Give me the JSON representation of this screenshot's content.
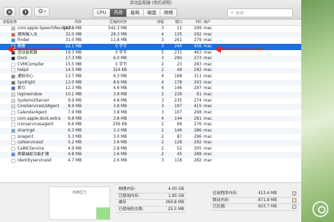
{
  "window": {
    "title": "活动监视器 (我的进程)"
  },
  "toolbar": {
    "close_glyph": "×",
    "info_glyph": "i",
    "gear_glyph": "⚙",
    "caret_glyph": "▾"
  },
  "tabs": [
    {
      "label": "CPU",
      "active": false
    },
    {
      "label": "内存",
      "active": true
    },
    {
      "label": "能耗",
      "active": false
    },
    {
      "label": "磁盘",
      "active": false
    },
    {
      "label": "网络",
      "active": false
    }
  ],
  "search": {
    "icon": "search-icon",
    "glyph": "⌕",
    "placeholder": "搜索"
  },
  "columns": {
    "name": "进程名称",
    "memory": "内存",
    "compressed": "压缩的内存",
    "threads": "线程",
    "ports": "端口",
    "pid": "PID",
    "user": "用户"
  },
  "processes": [
    {
      "name": "com.apple.SpeechRecognit...",
      "memory": "542.8 MB",
      "compressed": "542.3 MB",
      "threads": "3",
      "ports": "11",
      "pid": "299",
      "user": "mac",
      "color": "#bdbdbd"
    },
    {
      "name": "搜狗输入法",
      "memory": "32.0 MB",
      "compressed": "28.3 MB",
      "threads": "4",
      "ports": "135",
      "pid": "292",
      "user": "mac",
      "color": "#e3563b"
    },
    {
      "name": "Finder",
      "memory": "31.0 MB",
      "compressed": "11.8 MB",
      "threads": "3",
      "ports": "261",
      "pid": "279",
      "user": "mac",
      "color": "#3f8fe0"
    },
    {
      "name": "瞧瞧",
      "memory": "22.1 MB",
      "compressed": "0 字节",
      "threads": "3",
      "ports": "244",
      "pid": "456",
      "user": "mac",
      "color": "#2a6fd0"
    },
    {
      "name": "活动监视器",
      "memory": "19.3 MB",
      "compressed": "0 字节",
      "threads": "5",
      "ports": "231",
      "pid": "463",
      "user": "mac",
      "color": "#3b3b3b"
    },
    {
      "name": "Dock",
      "memory": "17.3 MB",
      "compressed": "6.0 MB",
      "threads": "3",
      "ports": "290",
      "pid": "273",
      "user": "mac",
      "color": "#222222"
    },
    {
      "name": "CVMCompiler",
      "memory": "15.5 MB",
      "compressed": "0 字节",
      "threads": "2",
      "ports": "23",
      "pid": "283",
      "user": "mac",
      "color": "#ffffff"
    },
    {
      "name": "helpd",
      "memory": "14.5 MB",
      "compressed": "324 KB",
      "threads": "2",
      "ports": "49",
      "pid": "292",
      "user": "mac",
      "color": "#ffffff"
    },
    {
      "name": "通知中心",
      "memory": "13.7 MB",
      "compressed": "6.3 MB",
      "threads": "4",
      "ports": "168",
      "pid": "311",
      "user": "mac",
      "color": "#8a8a8a"
    },
    {
      "name": "Spotlight",
      "memory": "13.0 MB",
      "compressed": "8.6 MB",
      "threads": "4",
      "ports": "178",
      "pid": "293",
      "user": "mac",
      "color": "#6e6e6e"
    },
    {
      "name": "索引",
      "memory": "12.3 MB",
      "compressed": "4.6 MB",
      "threads": "4",
      "ports": "146",
      "pid": "297",
      "user": "mac",
      "color": "#4a6fb0"
    },
    {
      "name": "loginwindow",
      "memory": "10.1 MB",
      "compressed": "3.8 MB",
      "threads": "2",
      "ports": "226",
      "pid": "91",
      "user": "mac",
      "color": "#d9d9d9"
    },
    {
      "name": "SystemUIServer",
      "memory": "9.9 MB",
      "compressed": "4.8 MB",
      "threads": "3",
      "ports": "235",
      "pid": "274",
      "user": "mac",
      "color": "#d9d9d9"
    },
    {
      "name": "CoreServicesUIAgent",
      "memory": "8.9 MB",
      "compressed": "3.8 MB",
      "threads": "3",
      "ports": "197",
      "pid": "415",
      "user": "mac",
      "color": "#d9d9d9"
    },
    {
      "name": "CalendarAgent",
      "memory": "7.9 MB",
      "compressed": "3.8 MB",
      "threads": "3",
      "ports": "107",
      "pid": "268",
      "user": "mac",
      "color": "#ffffff"
    },
    {
      "name": "com.apple.dock.extra",
      "memory": "6.8 MB",
      "compressed": "3.8 MB",
      "threads": "4",
      "ports": "144",
      "pid": "281",
      "user": "mac",
      "color": "#ececec"
    },
    {
      "name": "iconservicesagent",
      "memory": "6.6 MB",
      "compressed": "256 KB",
      "threads": "2",
      "ports": "66",
      "pid": "276",
      "user": "mac",
      "color": "#ffffff"
    },
    {
      "name": "sharingd",
      "memory": "6.3 MB",
      "compressed": "3.3 MB",
      "threads": "2",
      "ports": "146",
      "pid": "286",
      "user": "mac",
      "color": "#6fa9e8"
    },
    {
      "name": "soagent",
      "memory": "5.3 MB",
      "compressed": "3.0 MB",
      "threads": "2",
      "ports": "87",
      "pid": "296",
      "user": "mac",
      "color": "#ffffff"
    },
    {
      "name": "callservicesd",
      "memory": "5.2 MB",
      "compressed": "3.6 MB",
      "threads": "2",
      "ports": "128",
      "pid": "292",
      "user": "mac",
      "color": "#ffffff"
    },
    {
      "name": "CalNCService",
      "memory": "4.9 MB",
      "compressed": "2.8 MB",
      "threads": "2",
      "ports": "52",
      "pid": "305",
      "user": "mac",
      "color": "#ffffff"
    },
    {
      "name": "屏幕捕捉功能扩展",
      "memory": "4.8 MB",
      "compressed": "1.6 MB",
      "threads": "2",
      "ports": "45",
      "pid": "288",
      "user": "mac",
      "color": "#5a8fd6"
    },
    {
      "name": "identityservicesd",
      "memory": "4.7 MB",
      "compressed": "2.6 MB",
      "threads": "3",
      "ports": "118",
      "pid": "282",
      "user": "mac",
      "color": "#ffffff"
    }
  ],
  "selected_index": 3,
  "memory_pressure": {
    "label": "内存压力",
    "level": 0.38,
    "color": "#9ddd8f"
  },
  "memory_stats": [
    {
      "label": "物理内存:",
      "value": "4.00 GB"
    },
    {
      "label": "已使用内存:",
      "value": "1.85 GB"
    },
    {
      "label": "缓存",
      "value": "369.8 MB"
    },
    {
      "label": "已使用的交换:",
      "value": "25.5 MB"
    }
  ],
  "app_stats": [
    {
      "label": "应用程序内存:",
      "value": "413.4 MB"
    },
    {
      "label": "联动内存:",
      "value": "871.8 MB"
    },
    {
      "label": "已压缩:",
      "value": "603.7 MB"
    }
  ],
  "colors": {
    "selection": "#1e6fd9",
    "annotation_arrow": "#e02323",
    "pressure_green": "#9ddd8f"
  }
}
